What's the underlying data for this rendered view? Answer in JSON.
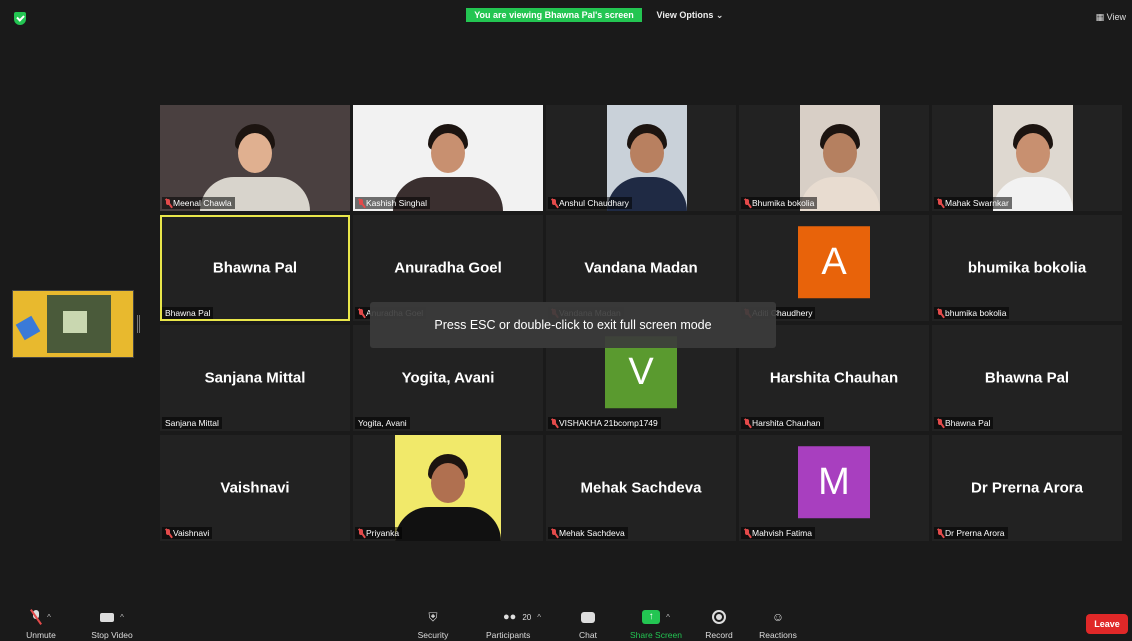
{
  "top": {
    "viewing_text": "You are viewing Bhawna Pal's screen",
    "view_options": "View Options ⌄",
    "view_button": "View"
  },
  "toast": "Press ESC or double-click to exit full screen mode",
  "tiles": [
    {
      "name": "",
      "label": "Meenal Chawla",
      "muted": true,
      "photo": true
    },
    {
      "name": "",
      "label": "Kashish Singhal",
      "muted": true,
      "photo": true
    },
    {
      "name": "",
      "label": "Anshul Chaudhary",
      "muted": true,
      "photo": true
    },
    {
      "name": "",
      "label": "Bhumika bokolia",
      "muted": true,
      "photo": true
    },
    {
      "name": "",
      "label": "Mahak Swarnkar",
      "muted": true,
      "photo": true
    },
    {
      "name": "Bhawna Pal",
      "label": "Bhawna Pal",
      "muted": false,
      "active": true
    },
    {
      "name": "Anuradha Goel",
      "label": "Anuradha Goel",
      "muted": true
    },
    {
      "name": "Vandana Madan",
      "label": "Vandana Madan",
      "muted": true
    },
    {
      "name": "A",
      "label": "Aditi Chaudhery",
      "muted": true,
      "avatar_color": "#e8630a"
    },
    {
      "name": "bhumika bokolia",
      "label": "bhumika bokolia",
      "muted": true
    },
    {
      "name": "Sanjana Mittal",
      "label": "Sanjana Mittal",
      "muted": false
    },
    {
      "name": "Yogita, Avani",
      "label": "Yogita, Avani",
      "muted": false
    },
    {
      "name": "V",
      "label": "VISHAKHA 21bcomp1749",
      "muted": true,
      "avatar_color": "#5a9a2f"
    },
    {
      "name": "Harshita Chauhan",
      "label": "Harshita Chauhan",
      "muted": true
    },
    {
      "name": "Bhawna Pal",
      "label": "Bhawna Pal",
      "muted": true
    },
    {
      "name": "Vaishnavi",
      "label": "Vaishnavi",
      "muted": true
    },
    {
      "name": "",
      "label": "Priyanka",
      "muted": true,
      "photo": true
    },
    {
      "name": "Mehak Sachdeva",
      "label": "Mehak Sachdeva",
      "muted": true
    },
    {
      "name": "M",
      "label": "Mahvish Fatima",
      "muted": true,
      "avatar_color": "#a83fbf"
    },
    {
      "name": "Dr Prerna Arora",
      "label": "Dr Prerna Arora",
      "muted": true
    }
  ],
  "toolbar": {
    "unmute": "Unmute",
    "stop_video": "Stop Video",
    "security": "Security",
    "participants": "Participants",
    "participants_count": "20",
    "chat": "Chat",
    "share_screen": "Share Screen",
    "record": "Record",
    "reactions": "Reactions",
    "leave": "Leave"
  },
  "colors": {
    "green": "#23c552",
    "leave_red": "#e02828",
    "active_border": "#e9e64a"
  }
}
